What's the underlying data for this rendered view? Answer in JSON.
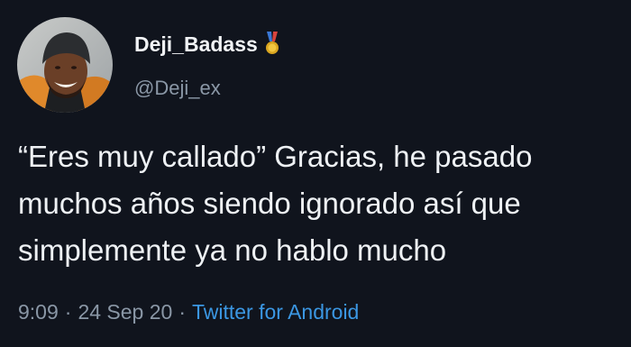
{
  "user": {
    "display_name": "Deji_Badass",
    "handle": "@Deji_ex",
    "badge_icon": "medal-icon"
  },
  "tweet": {
    "text": "“Eres muy callado” Gracias, he pasado muchos años siendo ignorado así que simplemente ya no hablo mucho",
    "time": "9:09",
    "date": "24 Sep 20",
    "separator": "·",
    "source": "Twitter for Android"
  },
  "colors": {
    "background": "#10141d",
    "text": "#eef1f4",
    "muted": "#8a97a6",
    "link": "#3b97e3"
  }
}
